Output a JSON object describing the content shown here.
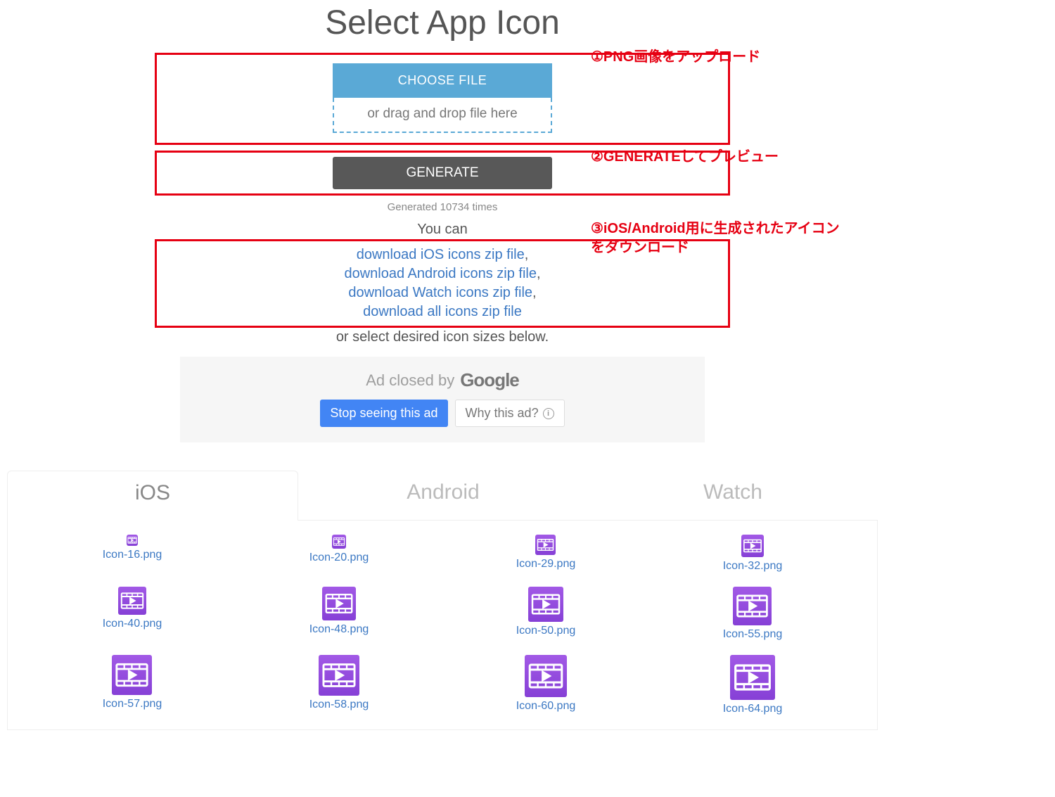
{
  "title": "Select App Icon",
  "upload": {
    "choose_file": "CHOOSE FILE",
    "drop_hint": "or drag and drop file here"
  },
  "generate": {
    "button": "GENERATE",
    "times": "Generated 10734 times"
  },
  "downloads": {
    "you_can": "You can",
    "ios": "download iOS icons zip file",
    "android": "download Android icons zip file",
    "watch": "download Watch icons zip file",
    "all": "download all icons zip file",
    "below": "or select desired icon sizes below."
  },
  "ad": {
    "closed": "Ad closed by",
    "google": "Google",
    "stop": "Stop seeing this ad",
    "why": "Why this ad?"
  },
  "annotations": {
    "a1": "①PNG画像をアップロード",
    "a2": "②GENERATEしてプレビュー",
    "a3": "③iOS/Android用に生成されたアイコンをダウンロード"
  },
  "tabs": {
    "ios": "iOS",
    "android": "Android",
    "watch": "Watch"
  },
  "icons": [
    {
      "size": 16,
      "label": "Icon-16.png"
    },
    {
      "size": 20,
      "label": "Icon-20.png"
    },
    {
      "size": 29,
      "label": "Icon-29.png"
    },
    {
      "size": 32,
      "label": "Icon-32.png"
    },
    {
      "size": 40,
      "label": "Icon-40.png"
    },
    {
      "size": 48,
      "label": "Icon-48.png"
    },
    {
      "size": 50,
      "label": "Icon-50.png"
    },
    {
      "size": 55,
      "label": "Icon-55.png"
    },
    {
      "size": 57,
      "label": "Icon-57.png"
    },
    {
      "size": 58,
      "label": "Icon-58.png"
    },
    {
      "size": 60,
      "label": "Icon-60.png"
    },
    {
      "size": 64,
      "label": "Icon-64.png"
    }
  ]
}
